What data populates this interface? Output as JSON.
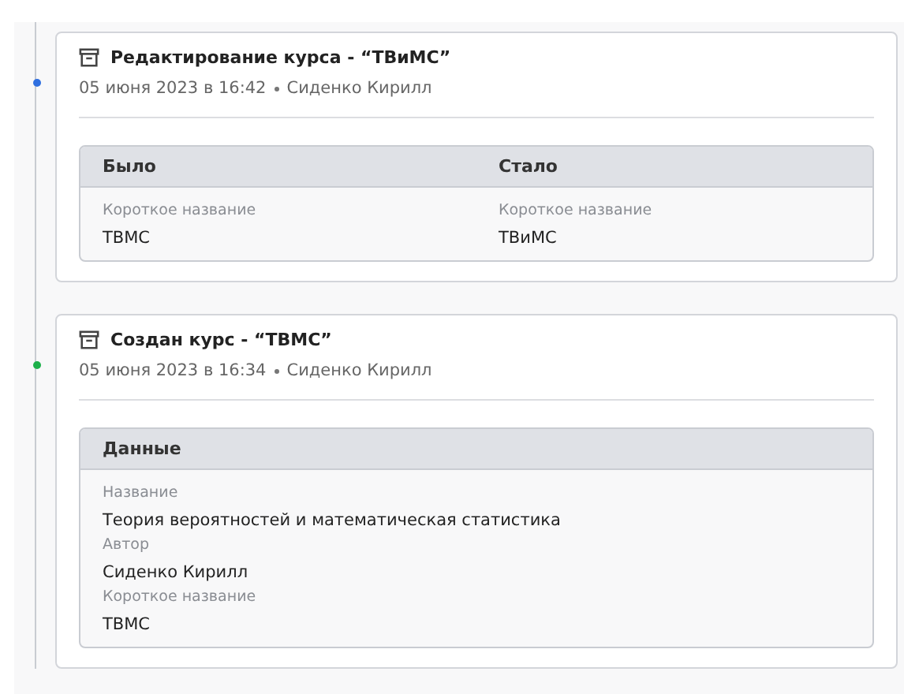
{
  "events": [
    {
      "color": "#2f6fe0",
      "title": "Редактирование курса - “ТВиМС”",
      "date": "05 июня 2023 в 16:42",
      "author": "Сиденко Кирилл",
      "table": {
        "columns": [
          {
            "header": "Было",
            "fields": [
              {
                "label": "Короткое название",
                "value": "ТВМС"
              }
            ]
          },
          {
            "header": "Стало",
            "fields": [
              {
                "label": "Короткое название",
                "value": "ТВиМС"
              }
            ]
          }
        ]
      }
    },
    {
      "color": "#1db04a",
      "title": "Создан курс - “ТВМС”",
      "date": "05 июня 2023 в 16:34",
      "author": "Сиденко Кирилл",
      "table": {
        "columns": [
          {
            "header": "Данные",
            "fields": [
              {
                "label": "Название",
                "value": "Теория вероятностей и математическая статистика"
              },
              {
                "label": "Автор",
                "value": "Сиденко Кирилл"
              },
              {
                "label": "Короткое название",
                "value": "ТВМС"
              }
            ]
          }
        ]
      }
    }
  ]
}
